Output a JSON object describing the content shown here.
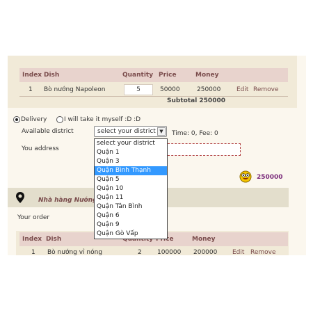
{
  "order_table": {
    "headers": [
      "Index",
      "Dish",
      "Quantity",
      "Price",
      "Money"
    ],
    "rows": [
      {
        "index": "1",
        "dish": "Bò nướng Napoleon",
        "quantity": "5",
        "price": "50000",
        "money": "250000",
        "edit": "Edit",
        "remove": "Remove"
      }
    ],
    "subtotal": "Subtotal 250000"
  },
  "delivery": {
    "option_delivery": "Delivery",
    "option_pickup": "I will take it myself :D :D",
    "available_district_label": "Available district",
    "selected_district": "select your district",
    "time_fee": "Time: 0, Fee: 0",
    "address_label": "You address"
  },
  "total": "250000",
  "district_options": [
    "select your district",
    "Quận 1",
    "Quận 3",
    "Quận Bình Thạnh",
    "Quận 5",
    "Quận 10",
    "Quận 11",
    "Quận Tân Bình",
    "Quận 6",
    "Quận 9",
    "Quận Gò Vấp"
  ],
  "highlighted_option_index": 3,
  "restaurant": {
    "name": "Nhà hàng Nướng",
    "your_order_label": "Your order"
  },
  "second_table": {
    "headers": [
      "Index",
      "Dish",
      "Quantity",
      "Price",
      "Money"
    ],
    "row": {
      "index": "1",
      "dish": "Bò nướng vỉ nóng",
      "quantity": "2",
      "price": "100000",
      "money": "200000",
      "edit": "Edit",
      "remove": "Remove"
    }
  },
  "colors": {
    "header_bg": "#e8d3cd",
    "accent_text": "#7a4c4c",
    "highlight": "#3399ff",
    "total_text": "#7a2a7a"
  }
}
